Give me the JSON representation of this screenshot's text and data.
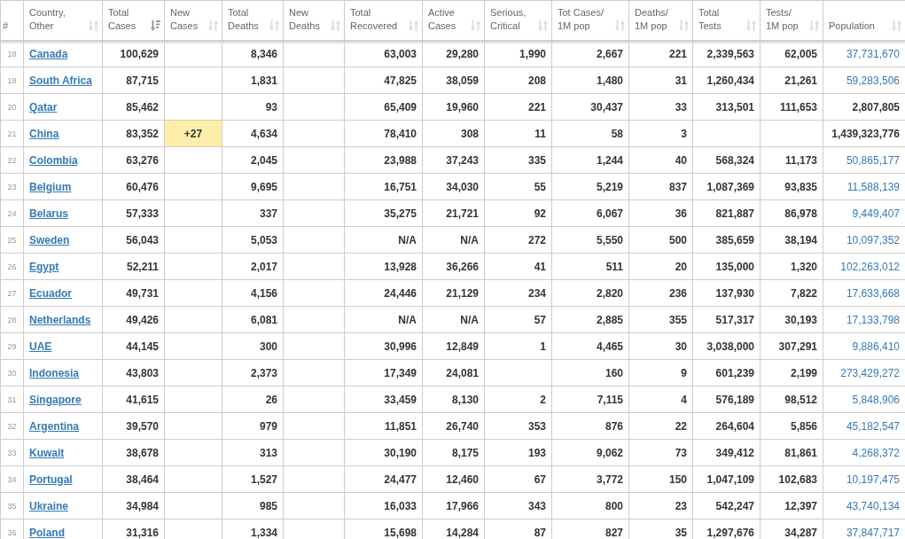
{
  "table": {
    "columns": [
      {
        "lines": [
          "#"
        ]
      },
      {
        "lines": [
          "Country,",
          "Other"
        ],
        "sorted": false
      },
      {
        "lines": [
          "Total",
          "Cases"
        ],
        "sorted": true
      },
      {
        "lines": [
          "New",
          "Cases"
        ],
        "sorted": false
      },
      {
        "lines": [
          "Total",
          "Deaths"
        ],
        "sorted": false
      },
      {
        "lines": [
          "New",
          "Deaths"
        ],
        "sorted": false
      },
      {
        "lines": [
          "Total",
          "Recovered"
        ],
        "sorted": false
      },
      {
        "lines": [
          "Active",
          "Cases"
        ],
        "sorted": false
      },
      {
        "lines": [
          "Serious,",
          "Critical"
        ],
        "sorted": false
      },
      {
        "lines": [
          "Tot Cases/",
          "1M pop"
        ],
        "sorted": false
      },
      {
        "lines": [
          "Deaths/",
          "1M pop"
        ],
        "sorted": false
      },
      {
        "lines": [
          "Total",
          "Tests"
        ],
        "sorted": false
      },
      {
        "lines": [
          "Tests/",
          "1M pop"
        ],
        "sorted": false
      },
      {
        "lines": [
          "Population"
        ],
        "sorted": false
      }
    ],
    "rows": [
      {
        "cells": [
          "18",
          "Canada",
          "100,629",
          "",
          "8,346",
          "",
          "63,003",
          "29,280",
          "1,990",
          "2,667",
          "221",
          "2,339,563",
          "62,005",
          "37,731,670"
        ],
        "population_link": true
      },
      {
        "cells": [
          "19",
          "South Africa",
          "87,715",
          "",
          "1,831",
          "",
          "47,825",
          "38,059",
          "208",
          "1,480",
          "31",
          "1,260,434",
          "21,261",
          "59,283,506"
        ],
        "population_link": true
      },
      {
        "cells": [
          "20",
          "Qatar",
          "85,462",
          "",
          "93",
          "",
          "65,409",
          "19,960",
          "221",
          "30,437",
          "33",
          "313,501",
          "111,653",
          "2,807,805"
        ],
        "population_link": false
      },
      {
        "cells": [
          "21",
          "China",
          "83,352",
          "+27",
          "4,634",
          "",
          "78,410",
          "308",
          "11",
          "58",
          "3",
          "",
          "",
          "1,439,323,776"
        ],
        "population_link": false
      },
      {
        "cells": [
          "22",
          "Colombia",
          "63,276",
          "",
          "2,045",
          "",
          "23,988",
          "37,243",
          "335",
          "1,244",
          "40",
          "568,324",
          "11,173",
          "50,865,177"
        ],
        "population_link": true
      },
      {
        "cells": [
          "23",
          "Belgium",
          "60,476",
          "",
          "9,695",
          "",
          "16,751",
          "34,030",
          "55",
          "5,219",
          "837",
          "1,087,369",
          "93,835",
          "11,588,139"
        ],
        "population_link": true
      },
      {
        "cells": [
          "24",
          "Belarus",
          "57,333",
          "",
          "337",
          "",
          "35,275",
          "21,721",
          "92",
          "6,067",
          "36",
          "821,887",
          "86,978",
          "9,449,407"
        ],
        "population_link": true
      },
      {
        "cells": [
          "25",
          "Sweden",
          "56,043",
          "",
          "5,053",
          "",
          "N/A",
          "N/A",
          "272",
          "5,550",
          "500",
          "385,659",
          "38,194",
          "10,097,352"
        ],
        "population_link": true
      },
      {
        "cells": [
          "26",
          "Egypt",
          "52,211",
          "",
          "2,017",
          "",
          "13,928",
          "36,266",
          "41",
          "511",
          "20",
          "135,000",
          "1,320",
          "102,263,012"
        ],
        "population_link": true
      },
      {
        "cells": [
          "27",
          "Ecuador",
          "49,731",
          "",
          "4,156",
          "",
          "24,446",
          "21,129",
          "234",
          "2,820",
          "236",
          "137,930",
          "7,822",
          "17,633,668"
        ],
        "population_link": true
      },
      {
        "cells": [
          "28",
          "Netherlands",
          "49,426",
          "",
          "6,081",
          "",
          "N/A",
          "N/A",
          "57",
          "2,885",
          "355",
          "517,317",
          "30,193",
          "17,133,798"
        ],
        "population_link": true
      },
      {
        "cells": [
          "29",
          "UAE",
          "44,145",
          "",
          "300",
          "",
          "30,996",
          "12,849",
          "1",
          "4,465",
          "30",
          "3,038,000",
          "307,291",
          "9,886,410"
        ],
        "population_link": true
      },
      {
        "cells": [
          "30",
          "Indonesia",
          "43,803",
          "",
          "2,373",
          "",
          "17,349",
          "24,081",
          "",
          "160",
          "9",
          "601,239",
          "2,199",
          "273,429,272"
        ],
        "population_link": true
      },
      {
        "cells": [
          "31",
          "Singapore",
          "41,615",
          "",
          "26",
          "",
          "33,459",
          "8,130",
          "2",
          "7,115",
          "4",
          "576,189",
          "98,512",
          "5,848,906"
        ],
        "population_link": true
      },
      {
        "cells": [
          "32",
          "Argentina",
          "39,570",
          "",
          "979",
          "",
          "11,851",
          "26,740",
          "353",
          "876",
          "22",
          "264,604",
          "5,856",
          "45,182,547"
        ],
        "population_link": true
      },
      {
        "cells": [
          "33",
          "Kuwait",
          "38,678",
          "",
          "313",
          "",
          "30,190",
          "8,175",
          "193",
          "9,062",
          "73",
          "349,412",
          "81,861",
          "4,268,372"
        ],
        "population_link": true
      },
      {
        "cells": [
          "34",
          "Portugal",
          "38,464",
          "",
          "1,527",
          "",
          "24,477",
          "12,460",
          "67",
          "3,772",
          "150",
          "1,047,109",
          "102,683",
          "10,197,475"
        ],
        "population_link": true
      },
      {
        "cells": [
          "35",
          "Ukraine",
          "34,984",
          "",
          "985",
          "",
          "16,033",
          "17,966",
          "343",
          "800",
          "23",
          "542,247",
          "12,397",
          "43,740,134"
        ],
        "population_link": true
      },
      {
        "cells": [
          "36",
          "Poland",
          "31,316",
          "",
          "1,334",
          "",
          "15,698",
          "14,284",
          "87",
          "827",
          "35",
          "1,297,676",
          "34,287",
          "37,847,717"
        ],
        "population_link": true
      }
    ]
  }
}
